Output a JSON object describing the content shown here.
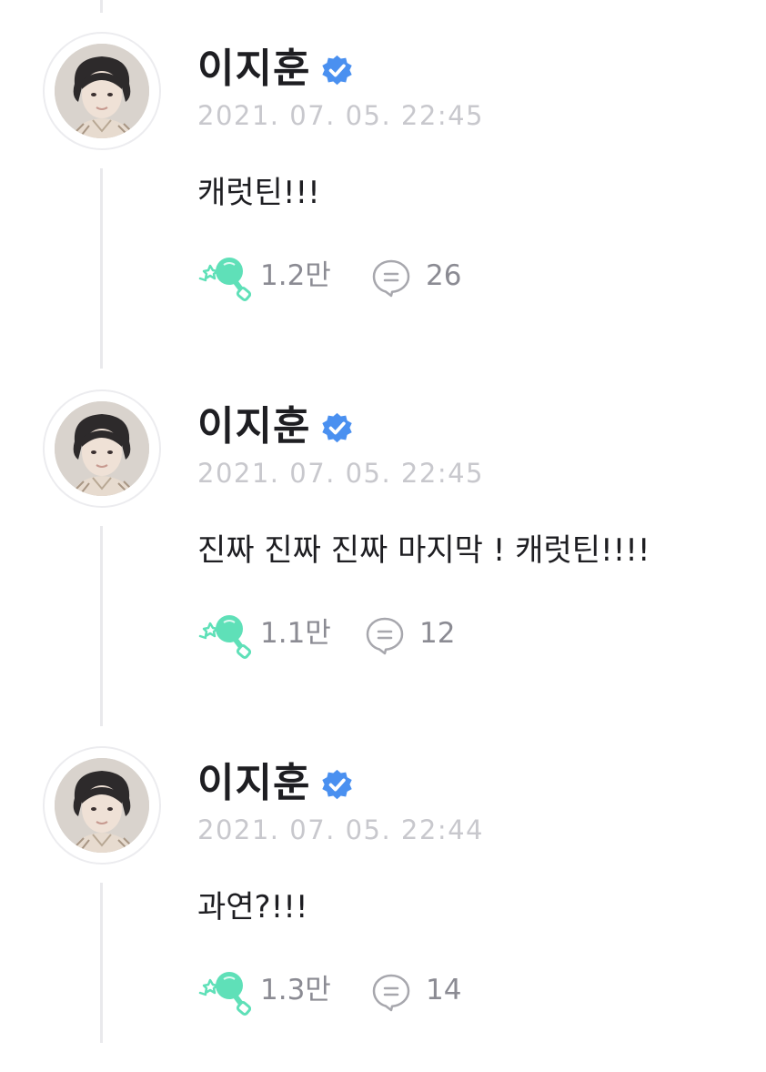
{
  "posts": [
    {
      "author": "이지훈",
      "timestamp": "2021. 07. 05. 22:45",
      "message": "캐럿틴!!!",
      "likes": "1.2만",
      "comments": "26"
    },
    {
      "author": "이지훈",
      "timestamp": "2021. 07. 05. 22:45",
      "message": "진짜 진짜 진짜 마지막 ! 캐럿틴!!!!",
      "likes": "1.1만",
      "comments": "12"
    },
    {
      "author": "이지훈",
      "timestamp": "2021. 07. 05. 22:44",
      "message": "과연?!!!",
      "likes": "1.3만",
      "comments": "14"
    }
  ],
  "icons": {
    "verified": "verified-check-icon",
    "like": "lightstick-icon",
    "comment": "comment-bubble-icon"
  },
  "colors": {
    "verified_blue": "#4a90f0",
    "like_mint": "#5fe0b8",
    "text_dark": "#1e1e22",
    "text_muted": "#8b8b93",
    "timestamp": "#c8c8cd"
  }
}
